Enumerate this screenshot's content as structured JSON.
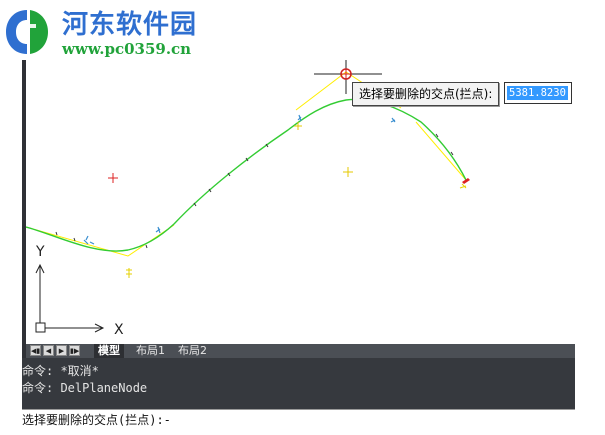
{
  "watermark": {
    "site_name": "河东软件园",
    "url": "www.pc0359.cn"
  },
  "tooltip": {
    "prompt": "选择要删除的交点(拦点):",
    "value": "5381.8230"
  },
  "ucs_icon": {
    "y_label": "Y",
    "x_label": "X"
  },
  "layout_tabs": {
    "nav_buttons": [
      "first-icon",
      "prev-icon",
      "next-icon",
      "last-icon"
    ],
    "tabs": [
      {
        "label": "模型",
        "active": true
      },
      {
        "label": "布局1",
        "active": false
      },
      {
        "label": "布局2",
        "active": false
      }
    ]
  },
  "command": {
    "history": [
      "命令: *取消*",
      "命令: DelPlaneNode"
    ],
    "current": "选择要删除的交点(拦点):-"
  },
  "colors": {
    "curve": "#33cc33",
    "construction": "#ffee00",
    "marker_red": "#dd2222",
    "tick": "#333333",
    "cursor": "#222222"
  }
}
